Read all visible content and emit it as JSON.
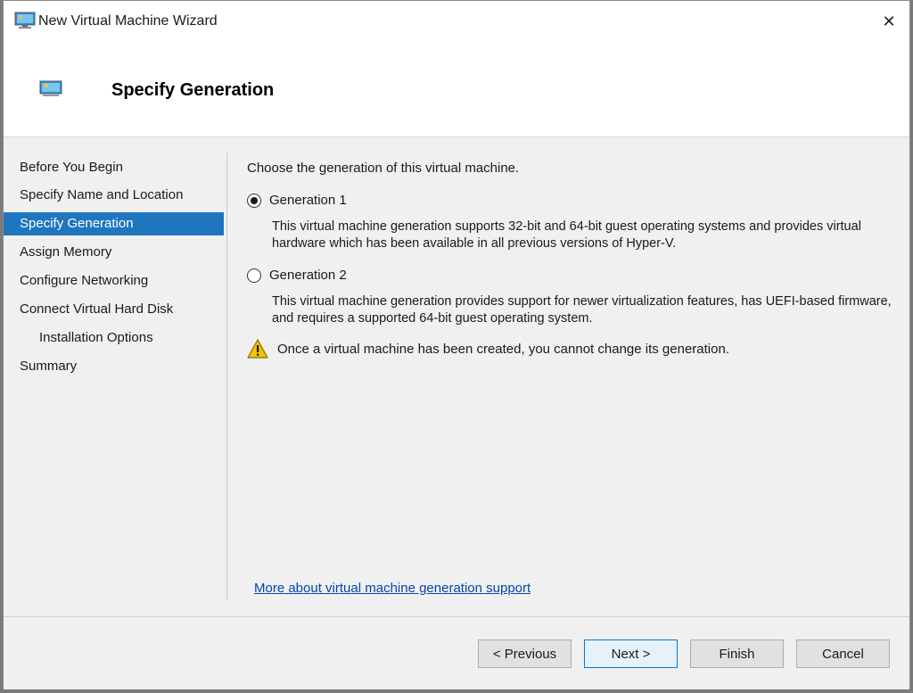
{
  "window": {
    "title": "New Virtual Machine Wizard",
    "close_glyph": "✕"
  },
  "header": {
    "title": "Specify Generation"
  },
  "nav": {
    "items": [
      {
        "label": "Before You Begin"
      },
      {
        "label": "Specify Name and Location"
      },
      {
        "label": "Specify Generation"
      },
      {
        "label": "Assign Memory"
      },
      {
        "label": "Configure Networking"
      },
      {
        "label": "Connect Virtual Hard Disk"
      },
      {
        "label": "Installation Options"
      },
      {
        "label": "Summary"
      }
    ],
    "active": "Specify Generation"
  },
  "content": {
    "intro": "Choose the generation of this virtual machine.",
    "generation1": {
      "label": "Generation 1",
      "checked": true,
      "description": "This virtual machine generation supports 32-bit and 64-bit guest operating systems and provides virtual hardware which has been available in all previous versions of Hyper-V."
    },
    "generation2": {
      "label": "Generation 2",
      "checked": false,
      "description": "This virtual machine generation provides support for newer virtualization features, has UEFI-based firmware, and requires a supported 64-bit guest operating system."
    },
    "warning": "Once a virtual machine has been created, you cannot change its generation.",
    "more_link": "More about virtual machine generation support"
  },
  "buttons": {
    "previous": "< Previous",
    "next": "Next >",
    "finish": "Finish",
    "cancel": "Cancel"
  },
  "colors": {
    "accent": "#1f76bf",
    "link": "#0645ad",
    "warning": "#f2c200"
  },
  "icons": {
    "app": "monitor-icon",
    "header": "monitor-icon",
    "warning": "warning-triangle-icon",
    "close": "close-icon"
  }
}
